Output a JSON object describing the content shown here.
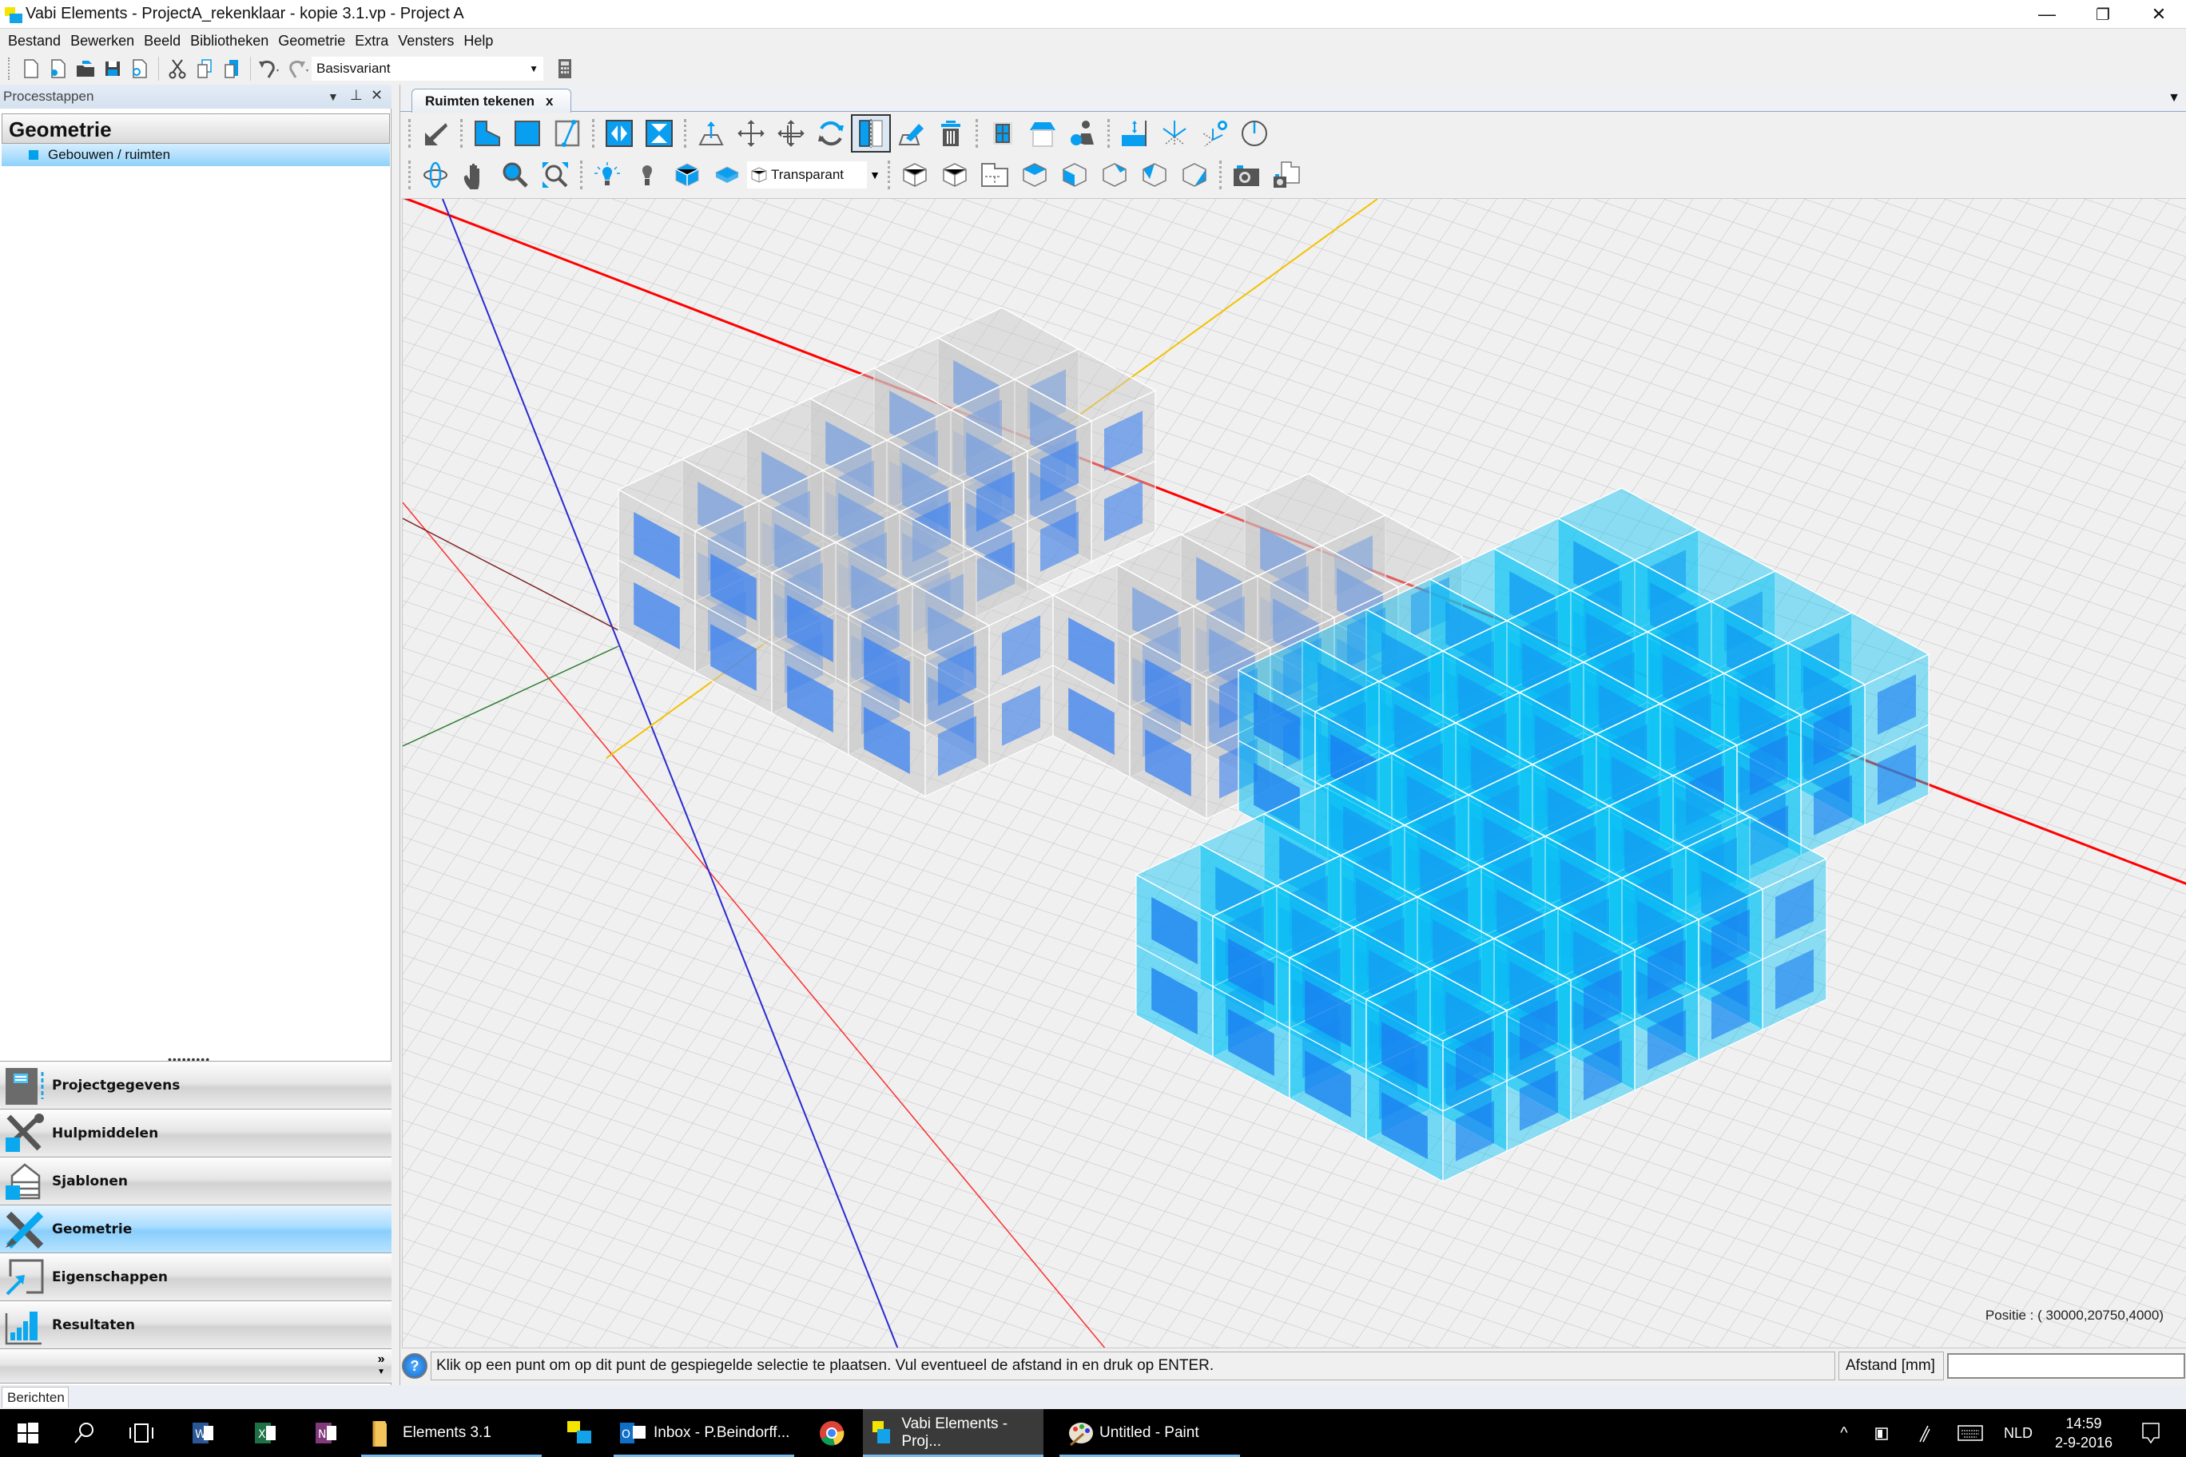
{
  "window": {
    "title": "Vabi Elements - ProjectA_rekenklaar - kopie 3.1.vp - Project A",
    "controls": {
      "minimize": "—",
      "restore": "❐",
      "close": "✕"
    }
  },
  "menu": [
    "Bestand",
    "Bewerken",
    "Beeld",
    "Bibliotheken",
    "Geometrie",
    "Extra",
    "Vensters",
    "Help"
  ],
  "main_toolbar": {
    "icons": [
      "new-file-icon",
      "new-from-template-icon",
      "open-folder-icon",
      "save-icon",
      "close-file-icon",
      "cut-icon",
      "copy-icon",
      "paste-icon",
      "undo-icon",
      "redo-icon",
      "calculator-icon"
    ],
    "variant_select": {
      "value": "Basisvariant"
    }
  },
  "left_panel": {
    "header": "Processtappen",
    "section_title": "Geometrie",
    "items": [
      {
        "label": "Gebouwen / ruimten",
        "selected": true
      }
    ],
    "splitter_grip": "•••••••••",
    "outlook_items": [
      {
        "label": "Projectgegevens",
        "icon": "project-data-icon",
        "active": false
      },
      {
        "label": "Hulpmiddelen",
        "icon": "tools-icon",
        "active": false
      },
      {
        "label": "Sjablonen",
        "icon": "templates-icon",
        "active": false
      },
      {
        "label": "Geometrie",
        "icon": "geometry-icon",
        "active": true
      },
      {
        "label": "Eigenschappen",
        "icon": "properties-icon",
        "active": false
      },
      {
        "label": "Resultaten",
        "icon": "results-icon",
        "active": false
      }
    ],
    "more_glyph": "»",
    "bottom_tab": "Berichten"
  },
  "document": {
    "tab": {
      "label": "Ruimten tekenen",
      "close": "x"
    },
    "toolbar_row1": [
      "select-arrow-icon",
      "draw-polygon-room-icon",
      "draw-rectangle-room-icon",
      "split-line-icon",
      "mirror-vertical-icon",
      "mirror-horizontal-icon",
      "extrude-up-icon",
      "move-icon",
      "move-copy-icon",
      "rotate-icon",
      "mirror-selection-icon",
      "edit-surface-icon",
      "delete-icon",
      "window-icon",
      "roof-icon",
      "assign-users-icon",
      "set-height-icon",
      "axis-icon",
      "reset-axis-icon",
      "clock-icon"
    ],
    "toolbar_row1_checked": "mirror-selection-icon",
    "toolbar_row2": [
      "orbit-icon",
      "pan-hand-icon",
      "zoom-icon",
      "zoom-extents-icon",
      "light-on-icon",
      "light-off-icon",
      "solid-view-icon",
      "shaded-view-icon"
    ],
    "view_mode": {
      "value": "Transparant"
    },
    "toolbar_row2_views": [
      "view-iso-1-icon",
      "view-iso-2-icon",
      "floorplan-icon",
      "view-top-icon",
      "view-front-icon",
      "view-right-icon",
      "view-left-icon",
      "view-back-icon",
      "camera-icon",
      "camera-floorplan-icon"
    ],
    "viewport": {
      "position_label": "Positie :",
      "position_value": "( 30000,20750,4000)",
      "colors": {
        "grid_bg": "#f0f0f0",
        "grid_line": "#c9c9c9",
        "axis_x": "#ff0000",
        "axis_y": "#f2c200",
        "axis_z": "#2a2ad0",
        "existing_building": "#c7c7c7",
        "mirrored_selection": "#0bc4f5",
        "window": "#3c82f0"
      }
    },
    "status": {
      "help_glyph": "?",
      "message": "Klik op een punt om op dit punt de gespiegelde selectie te plaatsen. Vul eventueel de afstand in en druk op ENTER.",
      "distance_label": "Afstand [mm]",
      "distance_value": ""
    }
  },
  "taskbar": {
    "items": [
      {
        "label": "",
        "icon": "windows-start-icon"
      },
      {
        "label": "",
        "icon": "search-icon"
      },
      {
        "label": "",
        "icon": "task-view-icon"
      },
      {
        "label": "",
        "icon": "word-icon"
      },
      {
        "label": "",
        "icon": "excel-icon"
      },
      {
        "label": "",
        "icon": "onenote-icon"
      },
      {
        "label": "Elements 3.1",
        "icon": "folder-icon"
      },
      {
        "label": "",
        "icon": "vabi-icon"
      },
      {
        "label": "Inbox - P.Beindorff...",
        "icon": "outlook-icon"
      },
      {
        "label": "",
        "icon": "chrome-icon"
      },
      {
        "label": "Vabi Elements - Proj...",
        "icon": "vabi-icon"
      },
      {
        "label": "Untitled - Paint",
        "icon": "paint-icon"
      }
    ],
    "tray": {
      "language": "NLD",
      "time": "14:59",
      "date": "2-9-2016",
      "chevron": "^"
    }
  }
}
